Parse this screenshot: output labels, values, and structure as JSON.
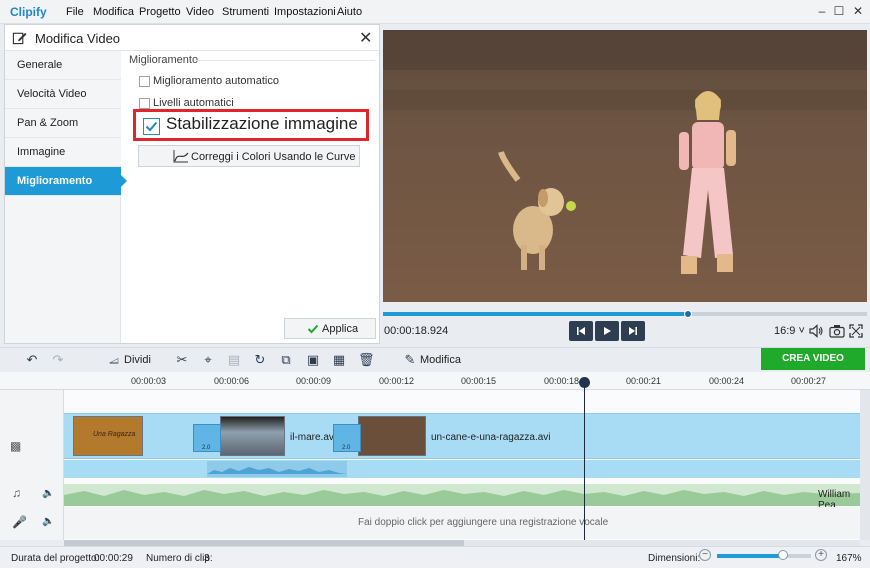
{
  "app": {
    "logo": "Clipify"
  },
  "menu": [
    "File",
    "Modifica",
    "Progetto",
    "Video",
    "Strumenti",
    "Impostazioni",
    "Aiuto"
  ],
  "window_controls": {
    "minimize": "–",
    "maximize": "☐",
    "close": "✕"
  },
  "panel": {
    "title": "Modifica Video",
    "close": "✕",
    "sidebar": [
      "Generale",
      "Velocità Video",
      "Pan & Zoom",
      "Immagine",
      "Miglioramento"
    ],
    "active_index": 4,
    "section_title": "Miglioramento",
    "options": [
      {
        "label": "Miglioramento automatico",
        "checked": false
      },
      {
        "label": "Livelli automatici",
        "checked": false
      }
    ],
    "highlighted_option": {
      "label": "Stabilizzazione immagine",
      "checked": true
    },
    "curves_button": "Correggi i Colori Usando le Curve",
    "apply_button": "Applica"
  },
  "player": {
    "timecode": "00:00:18.924",
    "progress": 0.63,
    "aspect": "16:9 ˅"
  },
  "toolbar": {
    "split": "Dividi",
    "edit": "Modifica",
    "create_video": "CREA VIDEO"
  },
  "ruler": {
    "ticks": [
      "00:00:03",
      "00:00:06",
      "00:00:09",
      "00:00:12",
      "00:00:15",
      "00:00:18",
      "00:00:21",
      "00:00:24",
      "00:00:27"
    ]
  },
  "timeline": {
    "clips": [
      {
        "title": "Una Ragazza",
        "name": ""
      },
      {
        "title": "",
        "name": "il-mare.avi"
      },
      {
        "title": "",
        "name": "un-cane-e-una-ragazza.avi"
      }
    ],
    "transition_duration": "2.0",
    "music_label": "William Pea",
    "voice_hint": "Fai doppio click per aggiungere una registrazione vocale"
  },
  "status": {
    "duration_label": "Durata del progetto:",
    "duration_value": "00:00:29",
    "clips_label": "Numero di clip:",
    "clips_value": "3",
    "zoom_label": "Dimensioni:",
    "zoom_value": "167%",
    "zoom_level": 0.7
  },
  "colors": {
    "accent": "#1e9ad6",
    "create": "#1faa2c",
    "highlight": "#e0252e"
  }
}
